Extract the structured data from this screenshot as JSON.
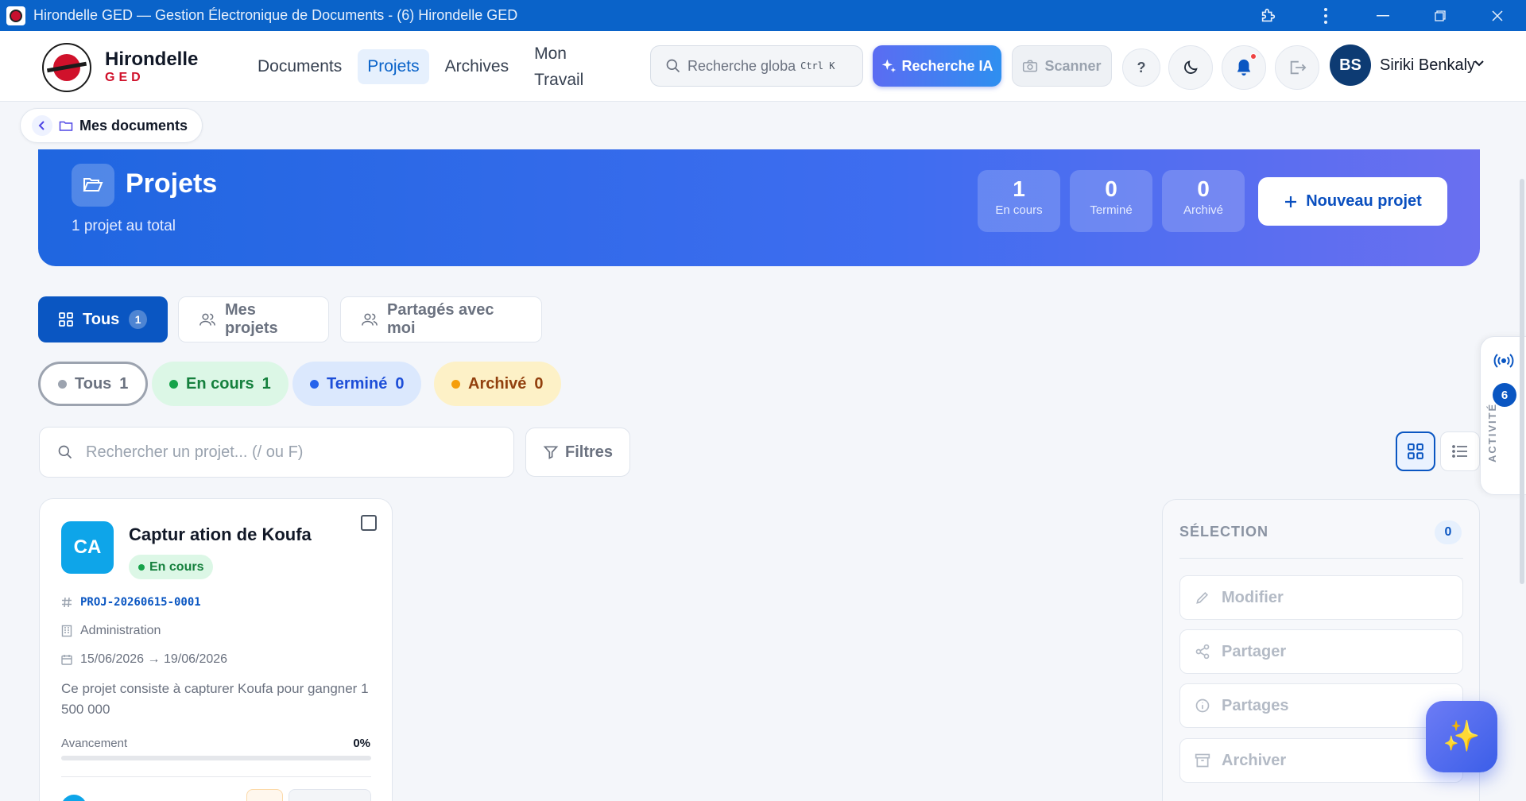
{
  "window": {
    "title": "Hirondelle GED — Gestion Électronique de Documents - (6) Hirondelle GED"
  },
  "brand": {
    "name": "Hirondelle",
    "sub": "GED"
  },
  "nav": {
    "documents": "Documents",
    "projets": "Projets",
    "archives": "Archives",
    "mon": "Mon",
    "travail": "Travail"
  },
  "header": {
    "search_placeholder": "Recherche globa",
    "search_shortcut": "Ctrl K",
    "ai_search": "Recherche IA",
    "scanner": "Scanner",
    "help": "?",
    "user_initials": "BS",
    "user_name": "Siriki Benkaly"
  },
  "breadcrumb": {
    "label": "Mes documents"
  },
  "hero": {
    "title": "Projets",
    "subtitle": "1 projet au total",
    "stats": [
      {
        "value": "1",
        "label": "En cours"
      },
      {
        "value": "0",
        "label": "Terminé"
      },
      {
        "value": "0",
        "label": "Archivé"
      }
    ],
    "new_project": "Nouveau projet"
  },
  "tabs": [
    {
      "label": "Tous",
      "count": "1"
    },
    {
      "label": "Mes projets"
    },
    {
      "label": "Partagés avec moi"
    }
  ],
  "status_filters": [
    {
      "label": "Tous",
      "count": "1",
      "color": "#9ca3af"
    },
    {
      "label": "En cours",
      "count": "1",
      "color": "#16a34a"
    },
    {
      "label": "Terminé",
      "count": "0",
      "color": "#2563eb"
    },
    {
      "label": "Archivé",
      "count": "0",
      "color": "#f59e0b"
    }
  ],
  "search": {
    "placeholder": "Rechercher un projet... (/ ou F)",
    "filters": "Filtres"
  },
  "project": {
    "initials": "CA",
    "title": "Captur ation de Koufa",
    "status": "En cours",
    "code": "PROJ-20260615-0001",
    "department": "Administration",
    "dates": "15/06/2026 → 19/06/2026",
    "description": "Ce projet consiste à capturer Koufa pour gangner 1 500 000",
    "progress_label": "Avancement",
    "progress_text": "0%",
    "progress": 0
  },
  "selection": {
    "title": "SÉLECTION",
    "count": "0",
    "actions": [
      "Modifier",
      "Partager",
      "Partages",
      "Archiver"
    ]
  },
  "activity": {
    "label": "ACTIVITÉ",
    "count": "6"
  },
  "colors": {
    "primary": "#0a56c2",
    "titlebar": "#0a63c9",
    "brand_red": "#d0112b"
  }
}
